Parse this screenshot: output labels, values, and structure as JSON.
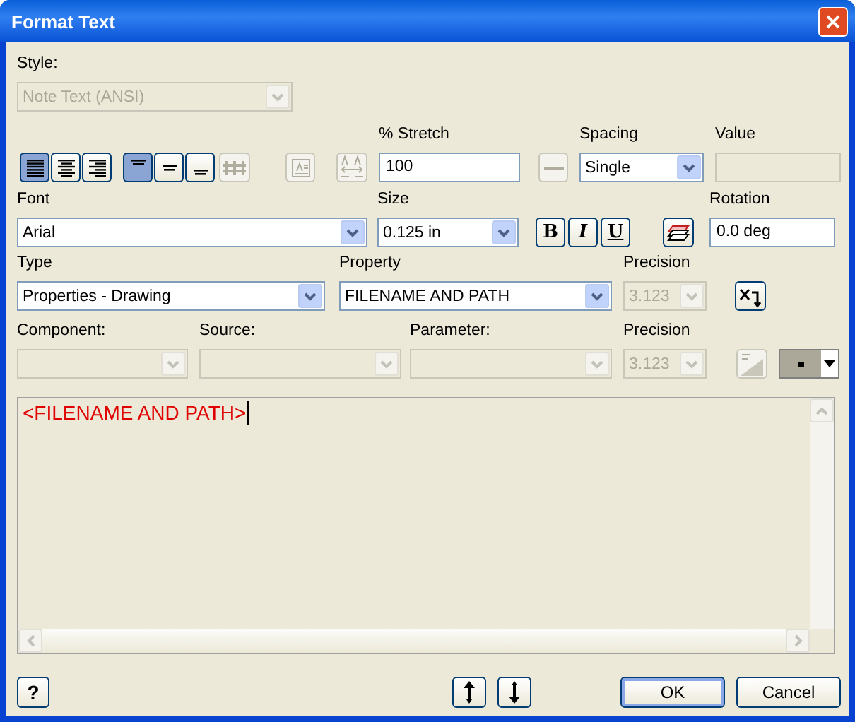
{
  "window": {
    "title": "Format Text"
  },
  "style": {
    "label": "Style:",
    "value": "Note Text (ANSI)",
    "disabled": true
  },
  "justify": [
    {
      "kind": "left",
      "selected": true
    },
    {
      "kind": "center",
      "selected": false
    },
    {
      "kind": "right",
      "selected": false
    }
  ],
  "vertical": [
    {
      "kind": "top",
      "selected": true
    },
    {
      "kind": "middle",
      "selected": false
    },
    {
      "kind": "bottom",
      "selected": false
    }
  ],
  "stack_button": {
    "disabled": true
  },
  "frame_button": {
    "disabled": true
  },
  "fit_button": {
    "disabled": true
  },
  "stretch": {
    "label": "% Stretch",
    "value": "100"
  },
  "spacing_button": {
    "disabled": true
  },
  "spacing": {
    "label": "Spacing",
    "value": "Single"
  },
  "value": {
    "label": "Value",
    "disabled": true
  },
  "font": {
    "label": "Font",
    "value": "Arial"
  },
  "size": {
    "label": "Size",
    "value": "0.125 in"
  },
  "format_buttons": [
    {
      "label": "B",
      "kind": "bold"
    },
    {
      "label": "I",
      "kind": "italic"
    },
    {
      "label": "U",
      "kind": "underline"
    }
  ],
  "layer_button": {
    "disabled": false
  },
  "rotation": {
    "label": "Rotation",
    "value": "0.0 deg"
  },
  "type": {
    "label": "Type",
    "value": "Properties - Drawing"
  },
  "property": {
    "label": "Property",
    "value": "FILENAME AND PATH"
  },
  "precision": {
    "label": "Precision",
    "value": "3.123",
    "disabled": true
  },
  "insert_button": {
    "disabled": false
  },
  "component": {
    "label": "Component:",
    "disabled": true
  },
  "source": {
    "label": "Source:",
    "disabled": true
  },
  "parameter": {
    "label": "Parameter:",
    "disabled": true
  },
  "precision_2": {
    "label": "Precision",
    "value": "3.123",
    "disabled": true
  },
  "tolerance_button": {
    "disabled": true
  },
  "color_picker": {
    "disabled": true
  },
  "editor": {
    "text": "<FILENAME AND PATH>"
  },
  "help_button": {
    "label": "?"
  },
  "buttons": [
    {
      "label": "OK",
      "kind": "default"
    },
    {
      "label": "Cancel",
      "kind": "normal"
    }
  ]
}
